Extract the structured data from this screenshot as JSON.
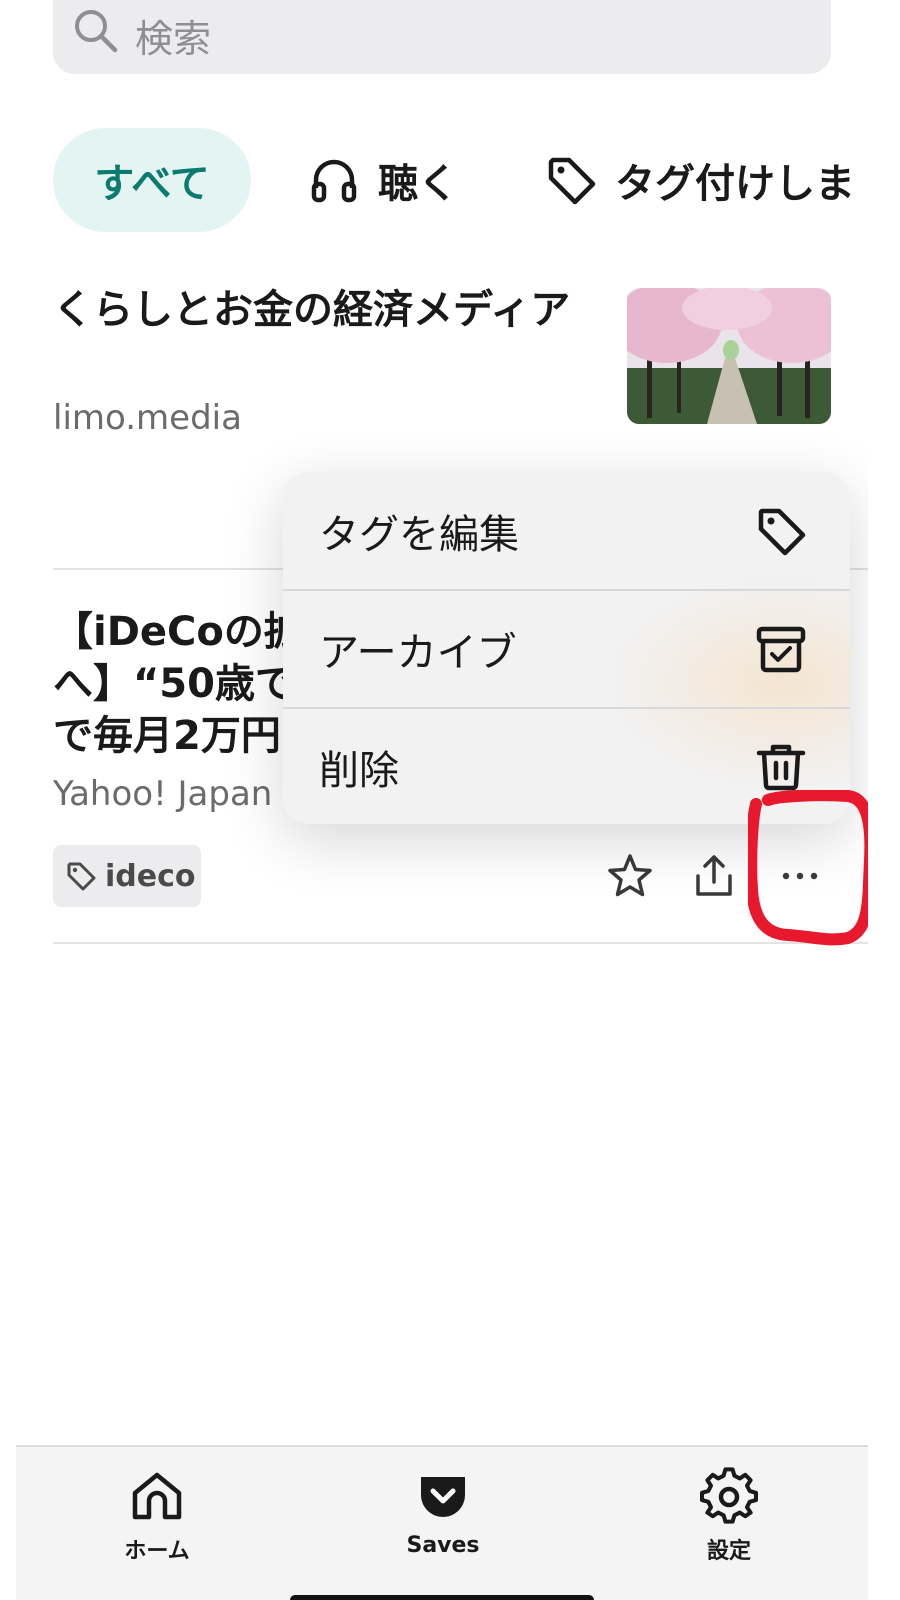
{
  "search": {
    "placeholder": "検索",
    "icon": "search-icon"
  },
  "filters": [
    {
      "label": "すべて",
      "selected": true
    },
    {
      "label": "聴く",
      "icon": "headphones-icon"
    },
    {
      "label": "タグ付けしま",
      "icon": "tag-icon"
    }
  ],
  "articles": [
    {
      "title": "くらしとお金の経済メディア",
      "source": "limo.media",
      "thumbnail": "cherry-blossom-path-image"
    },
    {
      "title": "【iDeCoの拡\nへ】“50歳で\nで毎月2万円",
      "source": "Yahoo! Japan",
      "tag": "ideco"
    }
  ],
  "context_menu": {
    "items": [
      {
        "label": "タグを編集",
        "icon": "tag-icon"
      },
      {
        "label": "アーカイブ",
        "icon": "archive-icon"
      },
      {
        "label": "削除",
        "icon": "trash-icon"
      }
    ]
  },
  "annotation": {
    "color": "#e8192c",
    "target": "more-button"
  },
  "tabbar": {
    "items": [
      {
        "label": "ホーム",
        "icon": "home-icon"
      },
      {
        "label": "Saves",
        "icon": "pocket-icon"
      },
      {
        "label": "設定",
        "icon": "gear-icon"
      }
    ]
  },
  "colors": {
    "accent": "#0b7a6f",
    "chip_bg": "#e3f4f3"
  }
}
